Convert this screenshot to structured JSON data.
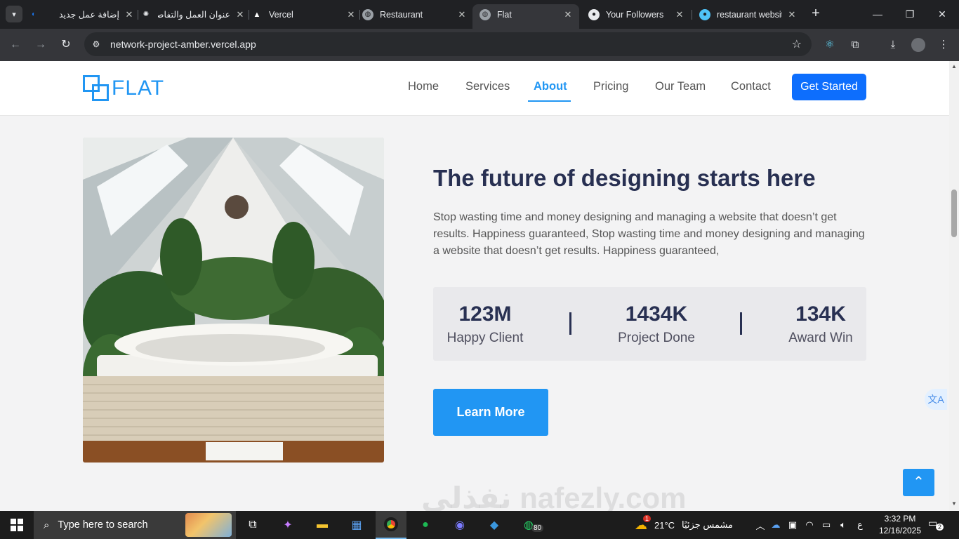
{
  "browser": {
    "tabs": [
      {
        "title": "إضافة عمل جديد",
        "icon": "nafezly-icon"
      },
      {
        "title": "عنوان العمل والتفاصيل",
        "icon": "chatgpt-icon"
      },
      {
        "title": "Vercel",
        "icon": "vercel-icon"
      },
      {
        "title": "Restaurant",
        "icon": "globe-icon"
      },
      {
        "title": "Flat",
        "icon": "globe-icon",
        "active": true
      },
      {
        "title": "Your Followers",
        "icon": "github-icon"
      },
      {
        "title": "restaurant website",
        "icon": "site-icon"
      }
    ],
    "url": "network-project-amber.vercel.app"
  },
  "site": {
    "logo": "FLAT",
    "nav": [
      "Home",
      "Services",
      "About",
      "Pricing",
      "Our Team",
      "Contact"
    ],
    "active_nav": "About",
    "cta": "Get Started"
  },
  "about": {
    "title": "The future of designing starts here",
    "text": "Stop wasting time and money designing and managing a website that doesn’t get results. Happiness guaranteed, Stop wasting time and money designing and managing a website that doesn’t get results. Happiness guaranteed,",
    "stats": [
      {
        "value": "123M",
        "label": "Happy Client"
      },
      {
        "value": "1434K",
        "label": "Project Done"
      },
      {
        "value": "134K",
        "label": "Award Win"
      }
    ],
    "button": "Learn More"
  },
  "watermark": "نفذلي nafezly.com",
  "taskbar": {
    "search_placeholder": "Type here to search",
    "weather_temp": "21°C",
    "weather_text": "مشمس جزئيًا",
    "weather_badge": "1",
    "lang": "ع",
    "time": "3:32 PM",
    "date": "12/16/2025",
    "notifications": "2",
    "app_badge": "80"
  },
  "colors": {
    "accent": "#2196f3",
    "cta": "#0d6efd",
    "heading": "#283052"
  }
}
